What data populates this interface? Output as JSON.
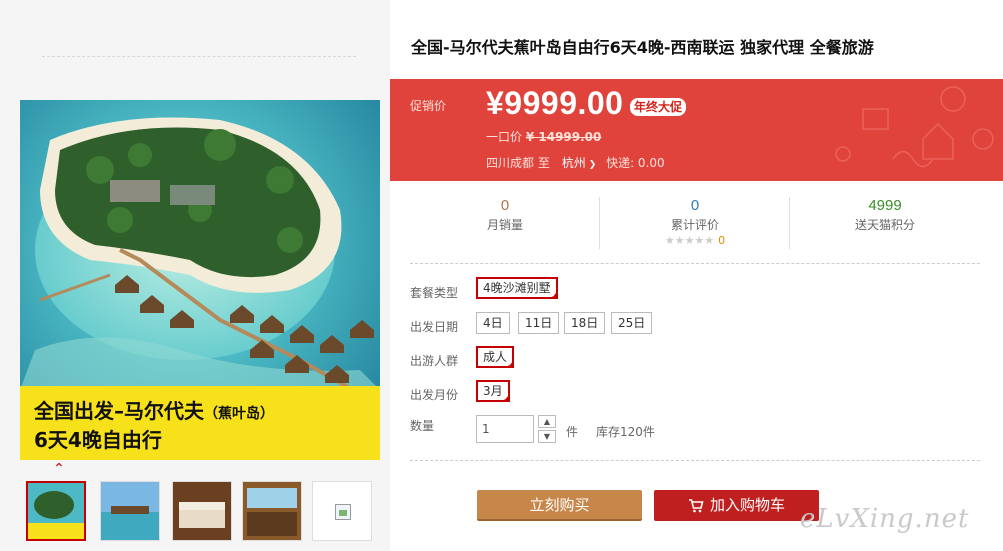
{
  "product": {
    "title": "全国-马尔代夫蕉叶岛自由行6天4晚-西南联运 独家代理 全餐旅游"
  },
  "gallery": {
    "banner_line1": "全国出发–马尔代夫",
    "banner_line1_small": "（蕉叶岛）",
    "banner_line2": "6天4晚自由行",
    "arrow_glyph": "⌃",
    "thumbnails": [
      "thumb-1",
      "thumb-2",
      "thumb-3",
      "thumb-4",
      "thumb-5"
    ]
  },
  "price": {
    "promo_label": "促销价",
    "current": "¥9999.00",
    "tag": "年终大促",
    "original_label": "一口价",
    "original_value": "¥ 14999.00",
    "origin": "四川成都",
    "to_label": "至",
    "destination": "杭州",
    "destination_chevron": "❯",
    "shipping": "快递: 0.00",
    "accent_color": "#e0433c"
  },
  "stats": {
    "monthly_sales": {
      "value": "0",
      "label": "月销量",
      "color": "#b0764a"
    },
    "reviews": {
      "value": "0",
      "label": "累计评价",
      "stars": "★★★★★",
      "star_count": "0",
      "color": "#2a7ab8"
    },
    "points": {
      "value": "4999",
      "label": "送天猫积分",
      "color": "#3a8f2a"
    }
  },
  "options": {
    "package_label": "套餐类型",
    "package_selected": "4晚沙滩别墅",
    "date_label": "出发日期",
    "dates": [
      "4日",
      "11日",
      "18日",
      "25日"
    ],
    "group_label": "出游人群",
    "group_selected": "成人",
    "month_label": "出发月份",
    "month_selected": "3月"
  },
  "quantity": {
    "label": "数量",
    "value": "1",
    "up": "▲",
    "down": "▼",
    "unit": "件",
    "stock": "库存120件"
  },
  "actions": {
    "buy_now": "立刻购买",
    "add_to_cart": "加入购物车"
  },
  "watermark": "eLvXing.net"
}
